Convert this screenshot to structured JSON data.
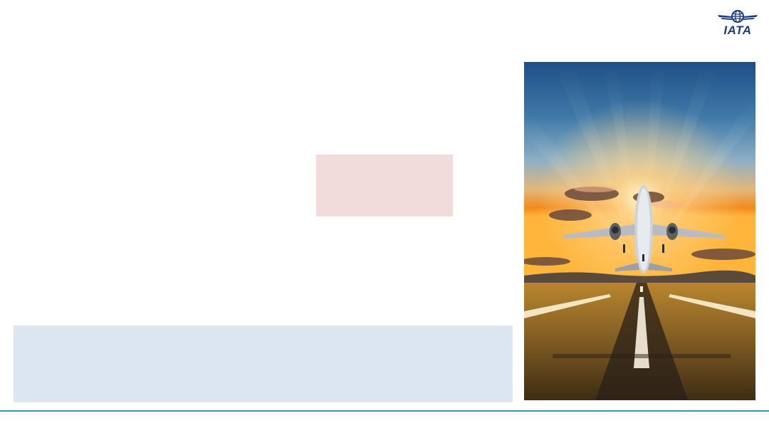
{
  "header": {
    "logo": {
      "text": "IATA",
      "icon": "globe-wings-icon",
      "color": "#1a3c87"
    }
  },
  "boxes": {
    "pink_color": "#f2dcdb",
    "blue_color": "#dce6f1"
  },
  "photo": {
    "subject": "airplane-takeoff-sunset-icon"
  },
  "footer": {
    "rule_color": "#2a9fb4"
  }
}
